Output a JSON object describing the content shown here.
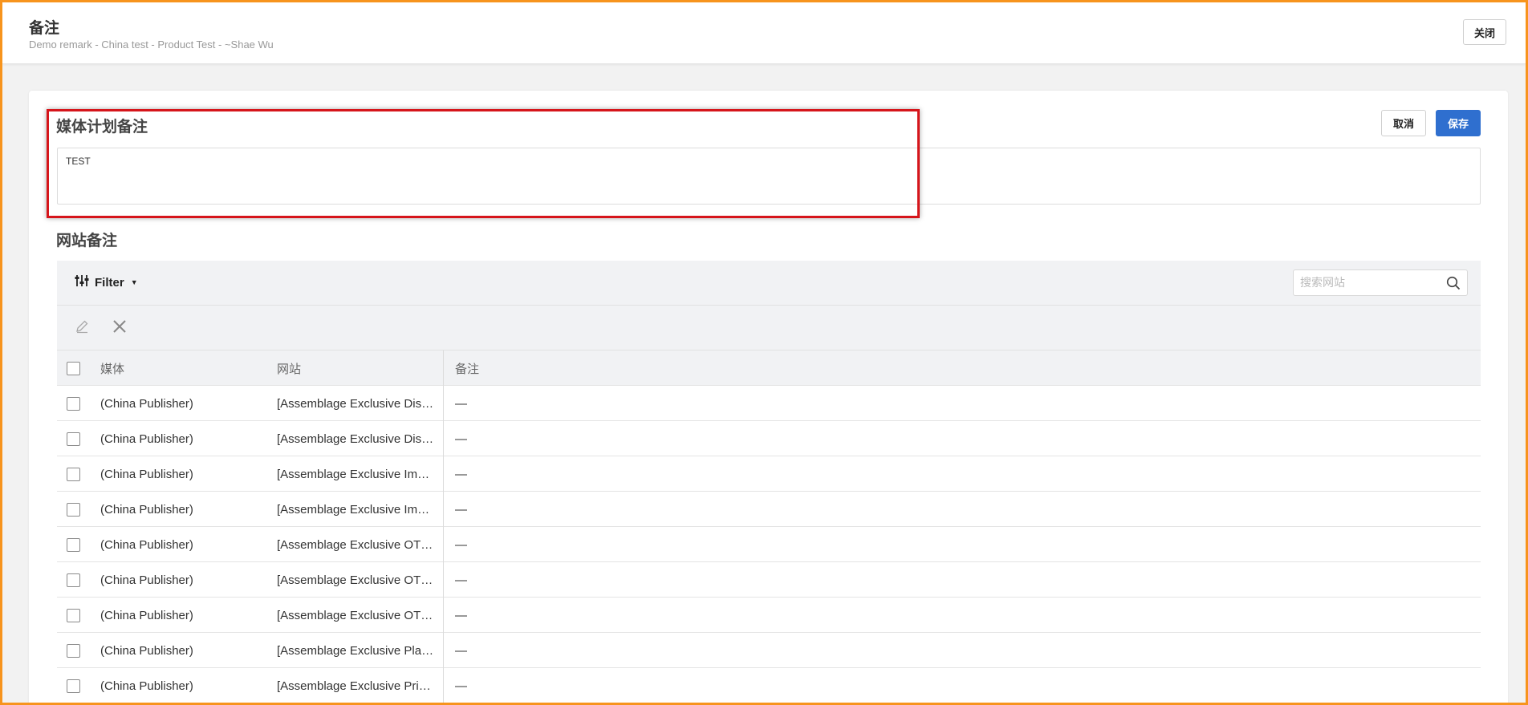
{
  "header": {
    "title": "备注",
    "subtitle": "Demo remark - China test - Product Test - ~Shae Wu",
    "close_label": "关闭"
  },
  "plan_remark": {
    "title": "媒体计划备注",
    "value": "TEST",
    "cancel_label": "取消",
    "save_label": "保存"
  },
  "site_remark": {
    "title": "网站备注",
    "filter_label": "Filter",
    "search_placeholder": "搜索网站",
    "columns": {
      "media": "媒体",
      "site": "网站",
      "note": "备注"
    },
    "rows": [
      {
        "media": "(China Publisher)",
        "site": "[Assemblage Exclusive Dis…",
        "note": "—"
      },
      {
        "media": "(China Publisher)",
        "site": "[Assemblage Exclusive Dis…",
        "note": "—"
      },
      {
        "media": "(China Publisher)",
        "site": "[Assemblage Exclusive Im…",
        "note": "—"
      },
      {
        "media": "(China Publisher)",
        "site": "[Assemblage Exclusive Im…",
        "note": "—"
      },
      {
        "media": "(China Publisher)",
        "site": "[Assemblage Exclusive OT…",
        "note": "—"
      },
      {
        "media": "(China Publisher)",
        "site": "[Assemblage Exclusive OT…",
        "note": "—"
      },
      {
        "media": "(China Publisher)",
        "site": "[Assemblage Exclusive OT…",
        "note": "—"
      },
      {
        "media": "(China Publisher)",
        "site": "[Assemblage Exclusive Pla…",
        "note": "—"
      },
      {
        "media": "(China Publisher)",
        "site": "[Assemblage Exclusive Pri…",
        "note": "—"
      }
    ]
  },
  "colors": {
    "frame_border": "#f7941d",
    "highlight_border": "#d6151b",
    "primary": "#2f6fcf"
  },
  "icons": {
    "filter": "sliders-icon",
    "search": "search-icon",
    "edit": "pencil-icon",
    "delete": "close-icon"
  }
}
